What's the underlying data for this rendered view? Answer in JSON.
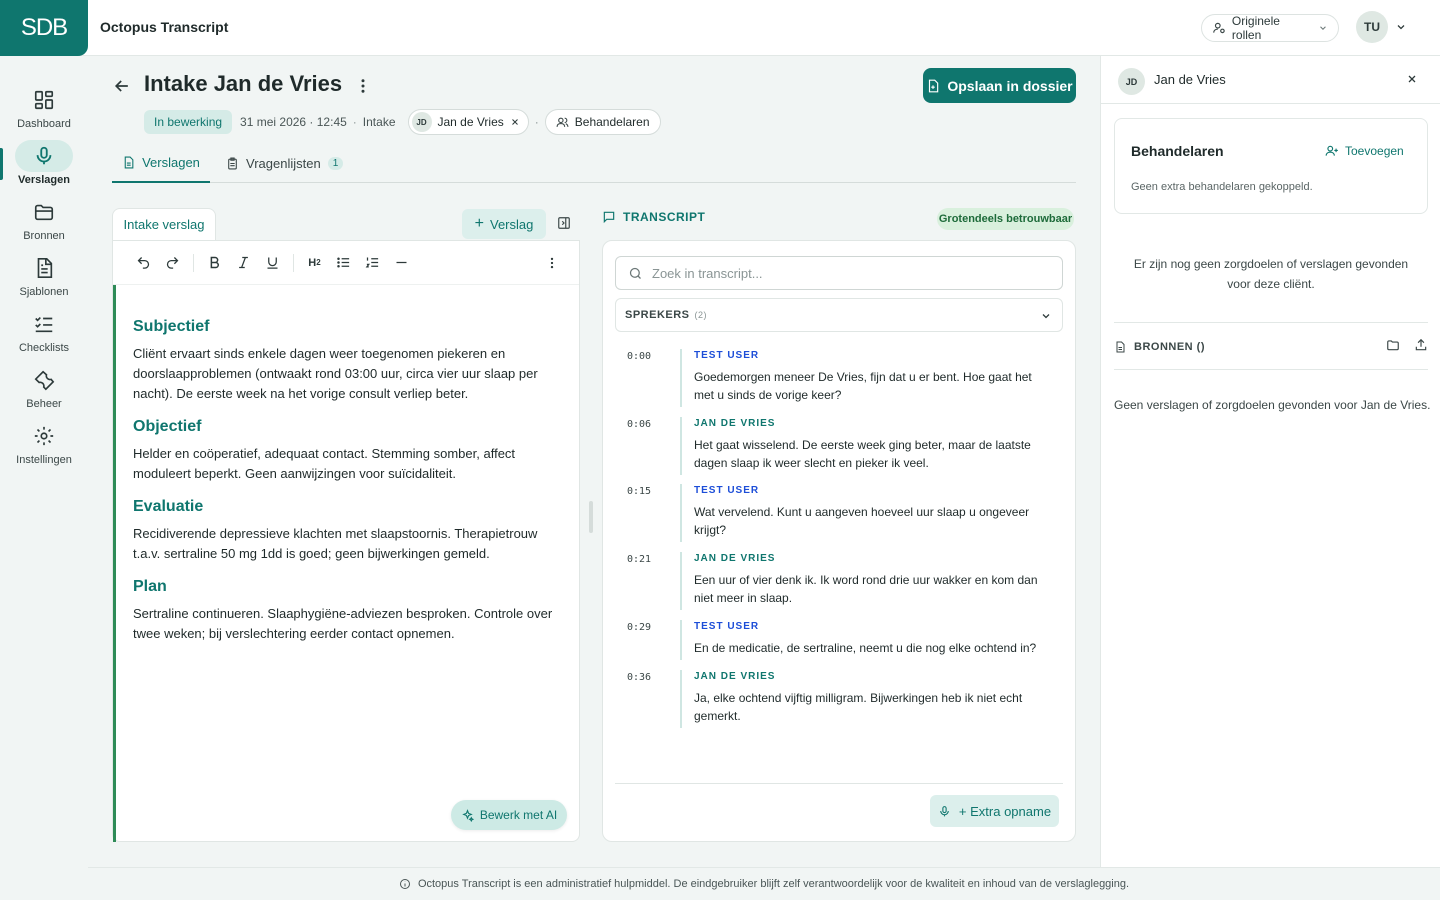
{
  "app": {
    "logo_text": "SDB",
    "title": "Octopus Transcript"
  },
  "topbar": {
    "roles_label": "Originele rollen",
    "user_initials": "TU"
  },
  "nav": {
    "items": [
      {
        "label": "Dashboard",
        "icon": "dashboard-icon"
      },
      {
        "label": "Verslagen",
        "icon": "microphone-icon",
        "active": true
      },
      {
        "label": "Bronnen",
        "icon": "folder-icon"
      },
      {
        "label": "Sjablonen",
        "icon": "document-icon"
      },
      {
        "label": "Checklists",
        "icon": "checklist-icon"
      },
      {
        "label": "Beheer",
        "icon": "wrench-icon"
      },
      {
        "label": "Instellingen",
        "icon": "gear-icon"
      }
    ]
  },
  "header": {
    "title": "Intake Jan de Vries",
    "save_label": "Opslaan in dossier",
    "status": "In bewerking",
    "datetime": "31 mei 2026 · 12:45",
    "type": "Intake",
    "patient_initials": "JD",
    "patient_name": "Jan de Vries",
    "behandelaren_label": "Behandelaren"
  },
  "tabs": [
    {
      "label": "Verslagen",
      "active": true
    },
    {
      "label": "Vragenlijsten",
      "count": "1"
    }
  ],
  "editor": {
    "tab_label": "Intake verslag",
    "add_label": "Verslag",
    "toolbar": [
      "undo-icon",
      "redo-icon",
      "bold-icon",
      "italic-icon",
      "underline-icon",
      "heading-icon",
      "bullet-list-icon",
      "numbered-list-icon",
      "horizontal-rule-icon",
      "more-icon"
    ],
    "sections": [
      {
        "heading": "Subjectief",
        "text": "Cliënt ervaart sinds enkele dagen weer toegenomen piekeren en doorslaapproblemen (ontwaakt rond 03:00 uur, circa vier uur slaap per nacht). De eerste week na het vorige consult verliep beter."
      },
      {
        "heading": "Objectief",
        "text": "Helder en coöperatief, adequaat contact. Stemming somber, affect moduleert beperkt. Geen aanwijzingen voor suïcidaliteit."
      },
      {
        "heading": "Evaluatie",
        "text": "Recidiverende depressieve klachten met slaapstoornis. Therapietrouw t.a.v. sertraline 50 mg 1dd is goed; geen bijwerkingen gemeld."
      },
      {
        "heading": "Plan",
        "text": "Sertraline continueren. Slaaphygiëne-adviezen besproken. Controle over twee weken; bij verslechtering eerder contact opnemen."
      }
    ],
    "ai_label": "Bewerk met AI"
  },
  "transcript": {
    "title": "TRANSCRIPT",
    "badge": "Grotendeels betrouwbaar",
    "search_placeholder": "Zoek in transcript...",
    "speakers_label": "SPREKERS",
    "speakers_count": "(2)",
    "utterances": [
      {
        "time": "0:00",
        "speaker": "TEST USER",
        "role": "user",
        "text": "Goedemorgen meneer De Vries, fijn dat u er bent. Hoe gaat het met u sinds de vorige keer?"
      },
      {
        "time": "0:06",
        "speaker": "JAN DE VRIES",
        "role": "patient",
        "text": "Het gaat wisselend. De eerste week ging beter, maar de laatste dagen slaap ik weer slecht en pieker ik veel."
      },
      {
        "time": "0:15",
        "speaker": "TEST USER",
        "role": "user",
        "text": "Wat vervelend. Kunt u aangeven hoeveel uur slaap u ongeveer krijgt?"
      },
      {
        "time": "0:21",
        "speaker": "JAN DE VRIES",
        "role": "patient",
        "text": "Een uur of vier denk ik. Ik word rond drie uur wakker en kom dan niet meer in slaap."
      },
      {
        "time": "0:29",
        "speaker": "TEST USER",
        "role": "user",
        "text": "En de medicatie, de sertraline, neemt u die nog elke ochtend in?"
      },
      {
        "time": "0:36",
        "speaker": "JAN DE VRIES",
        "role": "patient",
        "text": "Ja, elke ochtend vijftig milligram. Bijwerkingen heb ik niet echt gemerkt."
      }
    ],
    "extra_label": "+ Extra opname"
  },
  "right_panel": {
    "patient_initials": "JD",
    "patient_name": "Jan de Vries",
    "behandelaren_title": "Behandelaren",
    "add_label": "Toevoegen",
    "behandelaren_empty": "Geen extra behandelaren gekoppeld.",
    "empty_goals": "Er zijn nog geen zorgdoelen of verslagen gevonden voor deze cliënt.",
    "bronnen_label": "BRONNEN ()",
    "empty_reports": "Geen verslagen of zorgdoelen gevonden voor Jan de Vries."
  },
  "footer": {
    "disclaimer": "Octopus Transcript is een administratief hulpmiddel. De eindgebruiker blijft zelf verantwoordelijk voor de kwaliteit en inhoud van de verslaglegging."
  },
  "colors": {
    "brand": "#0f766e",
    "user_speaker": "#1d4ed8",
    "accent_border": "#2e8b57"
  }
}
